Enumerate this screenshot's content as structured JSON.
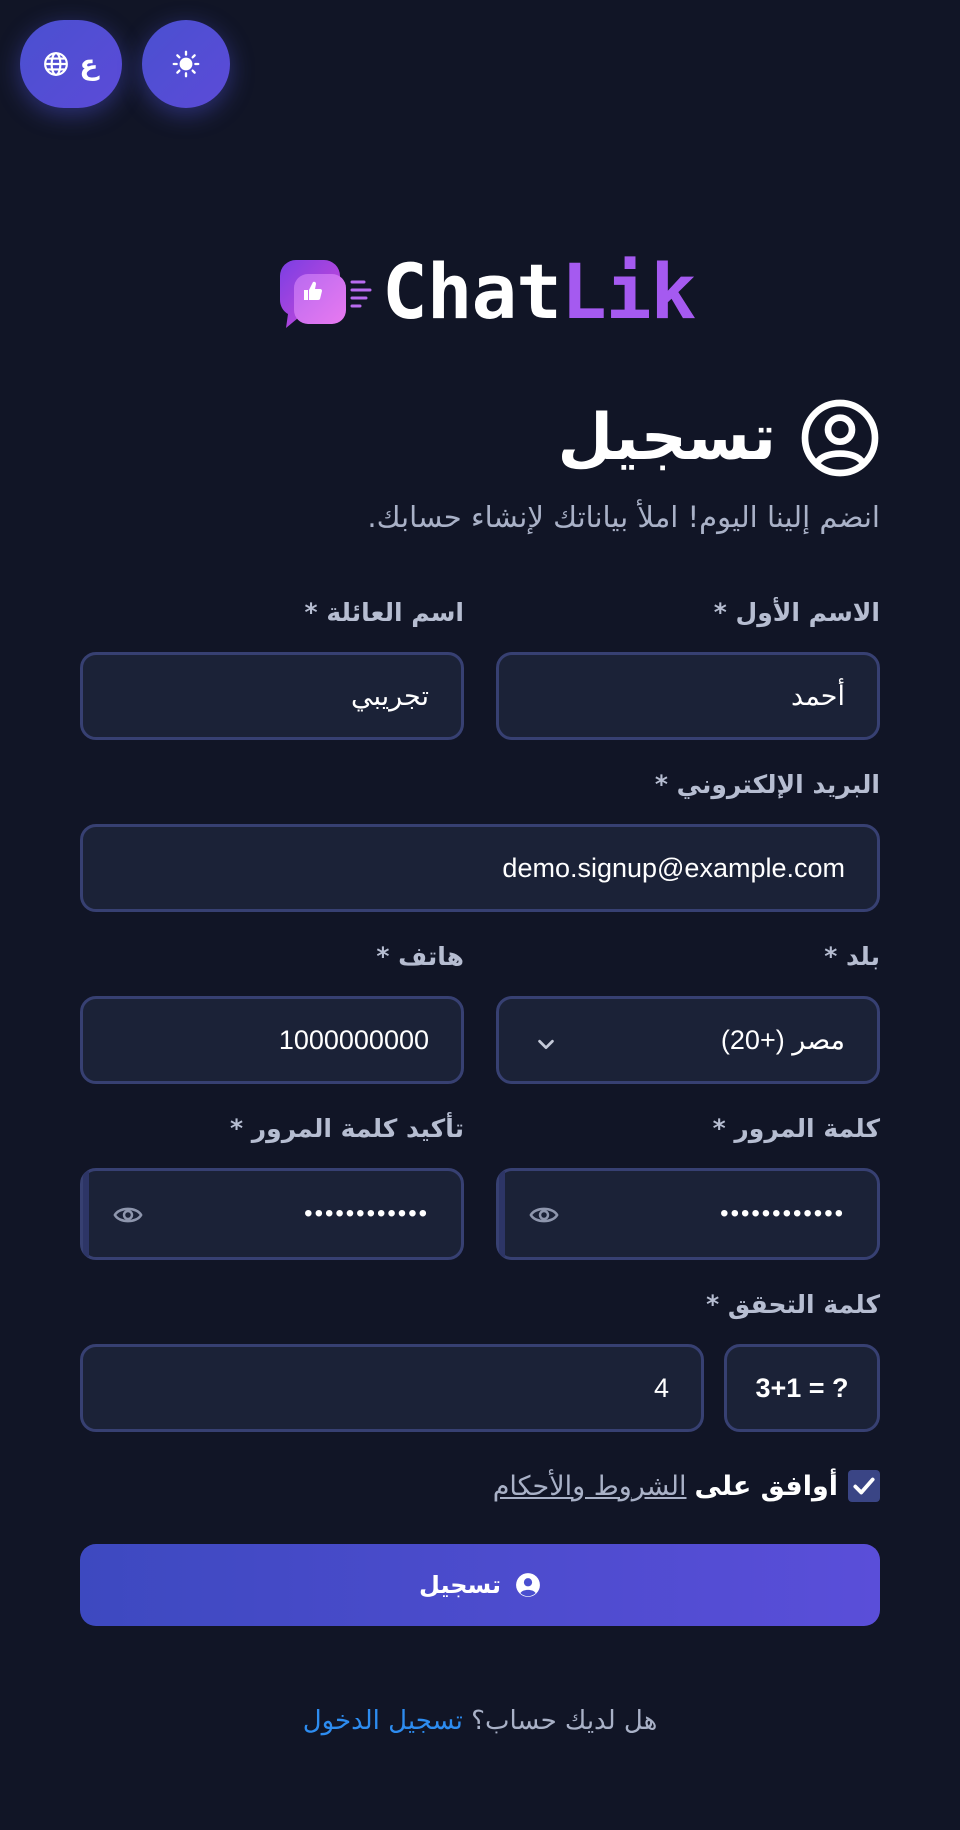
{
  "top_buttons": {
    "language_label": "ع",
    "language_icon": "globe-icon",
    "theme_icon": "sun-icon"
  },
  "brand": {
    "name_part1": "Chat",
    "name_part2": "Lik",
    "accent_color": "#a55af0"
  },
  "header": {
    "title": "تسجيل",
    "title_icon": "user-circle-icon",
    "subtitle": "انضم إلينا اليوم! املأ بياناتك لإنشاء حسابك."
  },
  "form": {
    "first_name": {
      "label": "الاسم الأول *",
      "value": "أحمد"
    },
    "last_name": {
      "label": "اسم العائلة *",
      "value": "تجريبي"
    },
    "email": {
      "label": "البريد الإلكتروني *",
      "value": "demo.signup@example.com"
    },
    "country": {
      "label": "بلد *",
      "value": "مصر (+20)"
    },
    "phone": {
      "label": "هاتف *",
      "value": "1000000000"
    },
    "password": {
      "label": "كلمة المرور *",
      "value": "••••••••••••"
    },
    "confirm_password": {
      "label": "تأكيد كلمة المرور *",
      "value": "••••••••••••"
    },
    "captcha": {
      "label": "كلمة التحقق *",
      "question": "3+1 = ?",
      "value": "4"
    },
    "terms": {
      "checked": true,
      "prefix": "أوافق على",
      "link": "الشروط والأحكام"
    },
    "submit_label": "تسجيل"
  },
  "footer": {
    "question": "هل لديك حساب؟",
    "login_link": "تسجيل الدخول"
  },
  "colors": {
    "background": "#111526",
    "field_bg": "#1b2237",
    "field_border": "#374072",
    "primary": "#4f4fd4",
    "link": "#2d8cf0"
  }
}
